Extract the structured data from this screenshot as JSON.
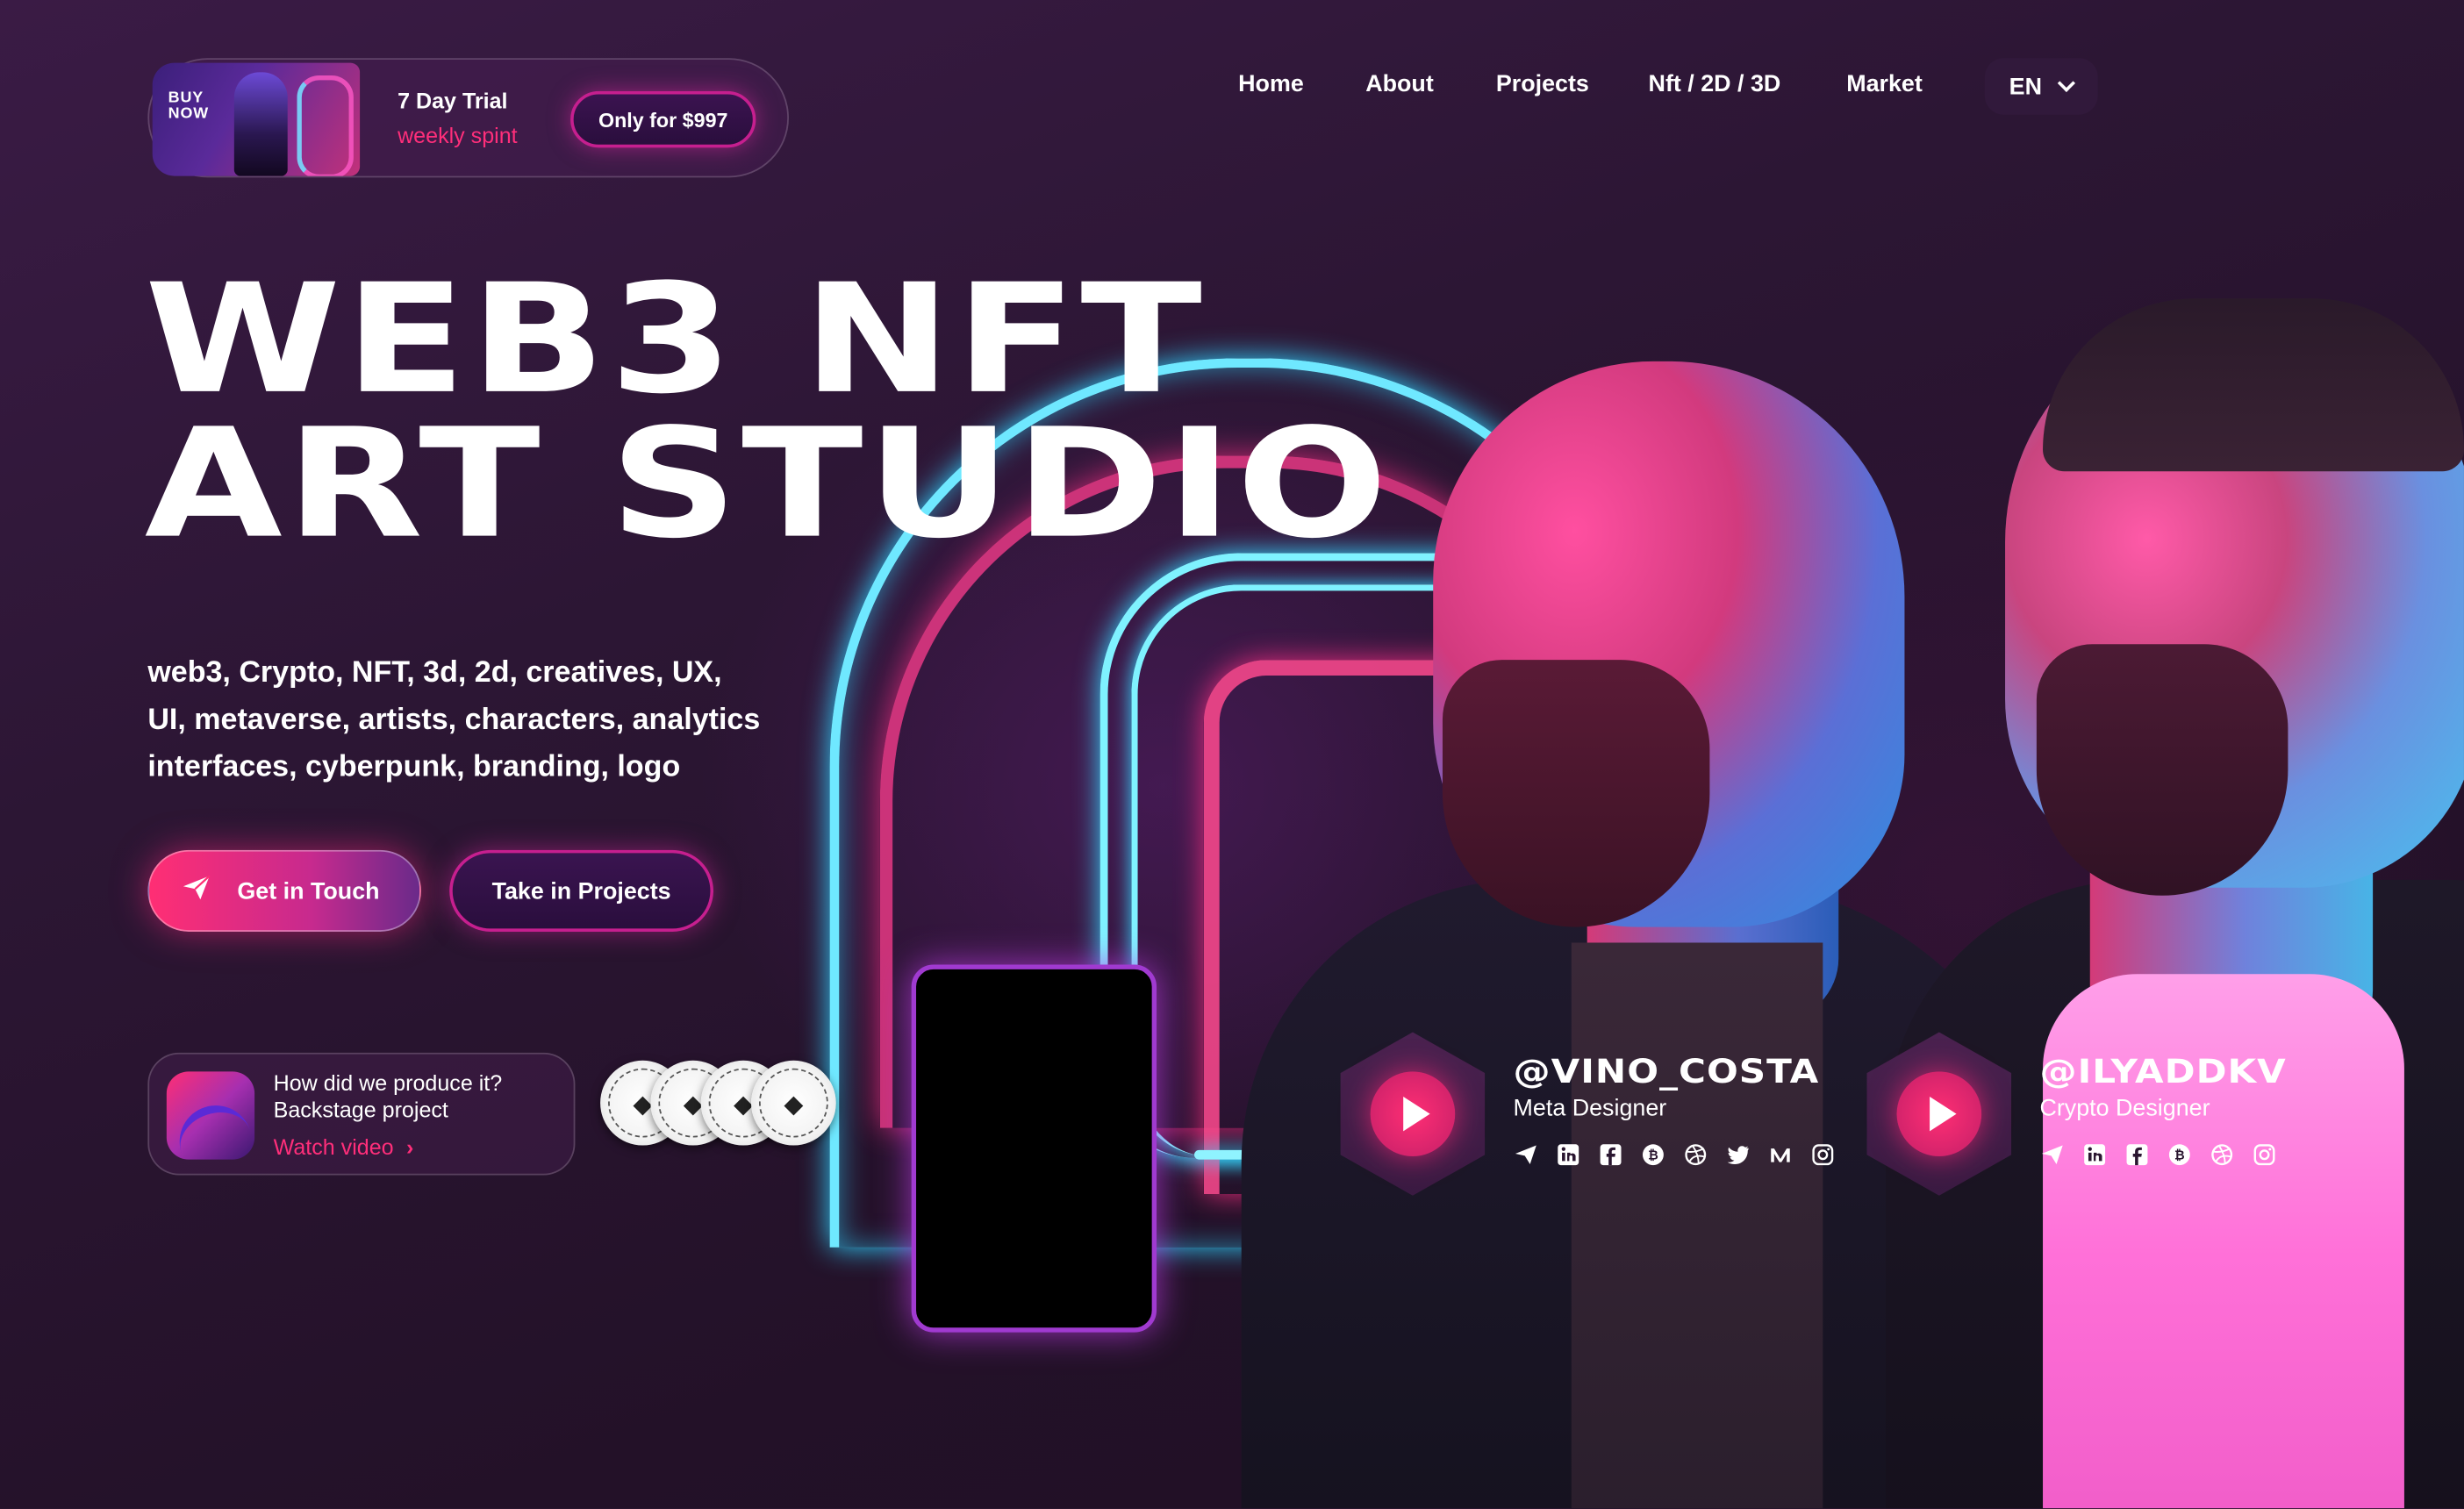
{
  "promo": {
    "thumb_text_line1": "BUY",
    "thumb_text_line2": "NOW",
    "title": "7 Day Trial",
    "subtitle": "weekly spint",
    "button_label": "Only for $997"
  },
  "nav": {
    "items": [
      {
        "label": "Home"
      },
      {
        "label": "About"
      },
      {
        "label": "Projects"
      },
      {
        "label": "Nft / 2D / 3D"
      },
      {
        "label": "Market"
      }
    ],
    "language": "EN"
  },
  "hero": {
    "headline_line1": "WEB3 NFT",
    "headline_line2": "ART STUDIO",
    "tagline_line1": "web3, Crypto, NFT, 3d, 2d, creatives, UX,",
    "tagline_line2": "UI, metaverse, artists, characters, analytics",
    "tagline_line3": "interfaces, cyberpunk, branding, logo",
    "primary_button": "Get in Touch",
    "secondary_button": "Take in Projects"
  },
  "backstage": {
    "line1": "How did we produce it?",
    "line2": "Backstage project",
    "link": "Watch video"
  },
  "awards": {
    "count": 4,
    "items": [
      {
        "icon": "award-badge-icon"
      },
      {
        "icon": "award-badge-icon"
      },
      {
        "icon": "award-badge-icon"
      },
      {
        "icon": "award-badge-icon"
      }
    ]
  },
  "designers": [
    {
      "handle": "@VINO_COSTA",
      "role": "Meta Designer",
      "socials": [
        "telegram-icon",
        "linkedin-icon",
        "facebook-icon",
        "bitcoin-icon",
        "dribbble-icon",
        "twitter-icon",
        "medium-icon",
        "instagram-icon"
      ]
    },
    {
      "handle": "@ILYADDKV",
      "role": "Crypto Designer",
      "socials": [
        "telegram-icon",
        "linkedin-icon",
        "facebook-icon",
        "bitcoin-icon",
        "dribbble-icon",
        "instagram-icon"
      ]
    }
  ],
  "colors": {
    "accent_pink": "#ff2e74",
    "neon_cyan": "#6fe8ff",
    "background": "#2c1634"
  }
}
